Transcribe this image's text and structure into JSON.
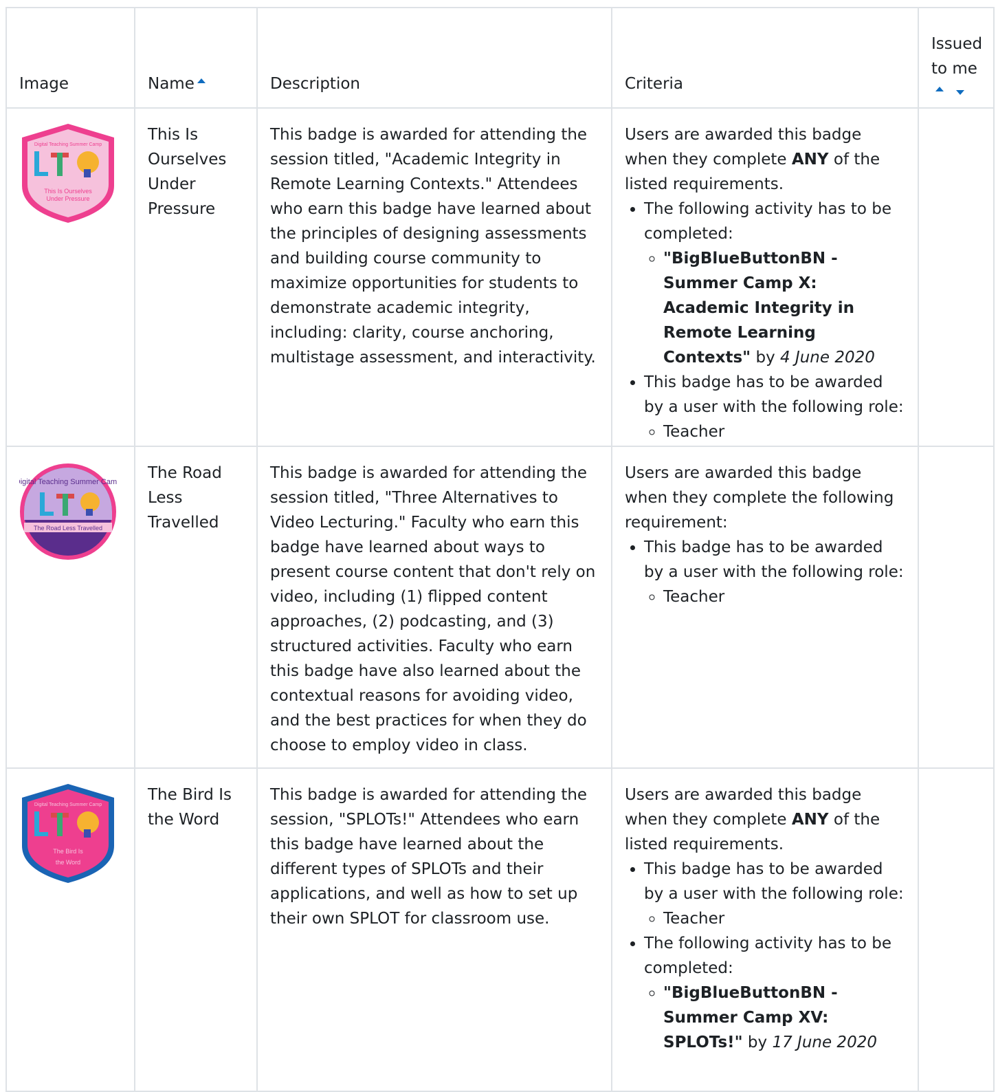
{
  "table": {
    "headers": {
      "image": "Image",
      "name": "Name",
      "description": "Description",
      "criteria": "Criteria",
      "issued": "Issued to me"
    },
    "rows": [
      {
        "badge_text": "Digital Teaching Summer Camp",
        "badge_caption": "This Is Ourselves Under Pressure",
        "name": "This Is Ourselves Under Pressure",
        "description": "This badge is awarded for attending the session titled, \"Academic Integrity in Remote Learning Contexts.\" Attendees who earn this badge have learned about the principles of designing assessments and building course community to maximize opportunities for students to demonstrate academic integrity, including: clarity, course anchoring, multistage assessment, and interactivity.",
        "criteria_intro_1": "Users are awarded this badge when they complete ",
        "criteria_intro_bold": "ANY",
        "criteria_intro_2": " of the listed requirements.",
        "c1": "The following activity has to be completed:",
        "c1_activity": "\"BigBlueButtonBN - Summer Camp X: Academic Integrity in Remote Learning Contexts\"",
        "c1_by": " by ",
        "c1_date": "4 June 2020",
        "c2": "This badge has to be awarded by a user with the following role:",
        "c2_role": "Teacher"
      },
      {
        "badge_text": "Digital Teaching Summer Camp",
        "badge_caption": "The Road Less Travelled",
        "name": "The Road Less Travelled",
        "description": "This badge is awarded for attending the session titled, \"Three Alternatives to Video Lecturing.\" Faculty who earn this badge have learned about ways to present course content that don't rely on video, including (1) flipped content approaches, (2) podcasting, and (3) structured activities. Faculty who earn this badge have also learned about the contextual reasons for avoiding video, and the best practices for when they do choose to employ video in class.",
        "criteria_intro": "Users are awarded this badge when they complete the following requirement:",
        "c1": "This badge has to be awarded by a user with the following role:",
        "c1_role": "Teacher"
      },
      {
        "badge_text": "Digital Teaching Summer Camp",
        "badge_caption": "The Bird Is the Word",
        "name": "The Bird Is the Word",
        "description": "This badge is awarded for attending the session, \"SPLOTs!\" Attendees who earn this badge have learned about the different types of SPLOTs and their applications, and well as how to set up their own SPLOT for classroom use.",
        "criteria_intro_1": "Users are awarded this badge when they complete ",
        "criteria_intro_bold": "ANY",
        "criteria_intro_2": " of the listed requirements.",
        "c1": "This badge has to be awarded by a user with the following role:",
        "c1_role": "Teacher",
        "c2": "The following activity has to be completed:",
        "c2_activity": "\"BigBlueButtonBN - Summer Camp XV: SPLOTs!\"",
        "c2_by": " by ",
        "c2_date": "17 June 2020"
      }
    ]
  },
  "colors": {
    "sort_arrow": "#0f6cbf",
    "border": "#dee2e6",
    "badge_pink": "#ee3f8f",
    "badge_blue": "#1a64b4",
    "badge_purple": "#5a2d8c"
  }
}
